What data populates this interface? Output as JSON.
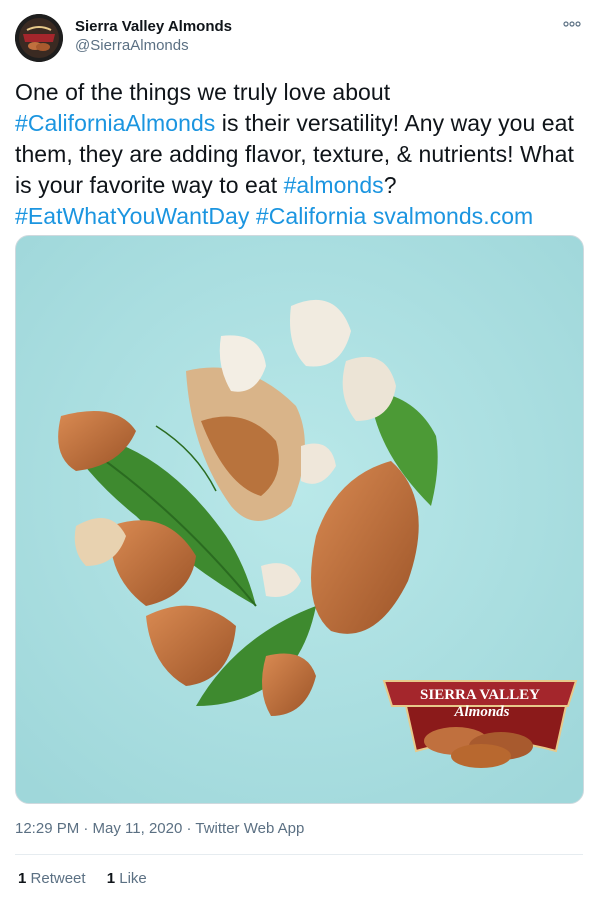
{
  "account": {
    "display_name": "Sierra Valley Almonds",
    "handle": "@SierraAlmonds",
    "avatar_icon": "brand-logo-avatar"
  },
  "tweet": {
    "text_parts": [
      {
        "text": "One of the things we truly love about ",
        "type": "text"
      },
      {
        "text": "#CaliforniaAlmonds",
        "type": "hashtag"
      },
      {
        "text": " is their versatility! Any way you eat them, they are adding flavor, texture, & nutrients! What is your favorite way to eat ",
        "type": "text"
      },
      {
        "text": "#almonds",
        "type": "hashtag"
      },
      {
        "text": "?",
        "type": "text"
      },
      {
        "text": "#EatWhatYouWantDay",
        "type": "hashtag",
        "newline_before": true
      },
      {
        "text": " ",
        "type": "text"
      },
      {
        "text": "#California",
        "type": "hashtag"
      },
      {
        "text": " ",
        "type": "text"
      },
      {
        "text": "svalmonds.com",
        "type": "url"
      }
    ],
    "timestamp": "12:29 PM · May 11, 2020 · Twitter Web App",
    "retweets_count": "1",
    "retweets_label": "Retweet",
    "likes_count": "1",
    "likes_label": "Like"
  },
  "media": {
    "logo_line1": "SIERRA VALLEY",
    "logo_line2": "Almonds"
  },
  "colors": {
    "link": "#1b95e0",
    "secondary_text": "#5b7083",
    "image_background": "#a8dee0",
    "almond": "#c0703e",
    "logo_red": "#8b1a1a"
  },
  "icons": {
    "more": "more-options-icon"
  }
}
